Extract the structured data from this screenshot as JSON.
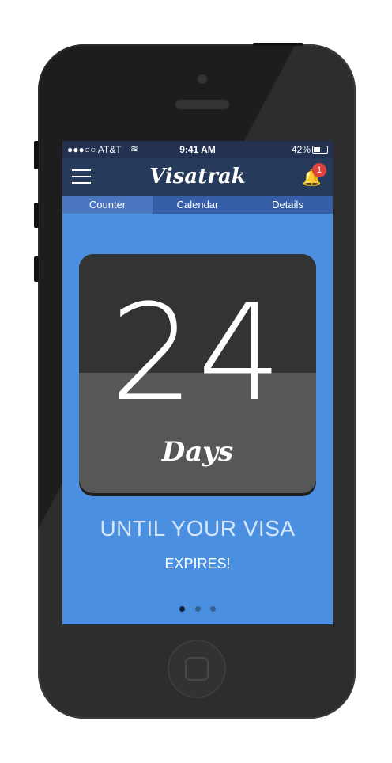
{
  "status_bar": {
    "carrier": "●●●○○ AT&T",
    "time": "9:41 AM",
    "battery": "42%"
  },
  "navbar": {
    "title": "Visatrak",
    "notification_count": "1"
  },
  "tabs": [
    {
      "label": "Counter"
    },
    {
      "label": "Calendar"
    },
    {
      "label": "Details"
    }
  ],
  "counter": {
    "value": "24",
    "unit": "Days"
  },
  "message": {
    "line1": "UNTIL YOUR VISA",
    "line2": "EXPIRES!"
  },
  "colors": {
    "screen_bg": "#4a8fe0",
    "navbar_bg": "#263a5b",
    "tab_active": "#4a77c0",
    "badge": "#e0403a"
  }
}
